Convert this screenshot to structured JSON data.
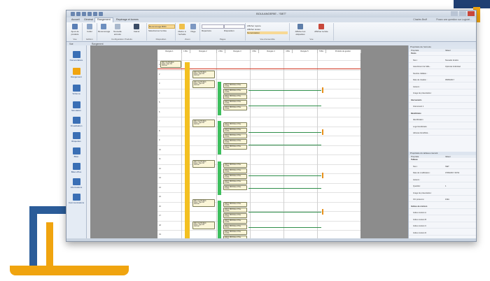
{
  "window": {
    "title": "BOULANGERIE - 'SIET'"
  },
  "tabs": [
    {
      "label": "Accueil"
    },
    {
      "label": "Général"
    },
    {
      "label": "Rangement"
    },
    {
      "label": "Repérage et bornes"
    }
  ],
  "tabs_right": {
    "user": "Charles Bruff",
    "search": "Posez une question sur Logiciel..."
  },
  "ribbon": {
    "groups": [
      {
        "label": "Vue"
      },
      {
        "label": "Edition"
      },
      {
        "label": "Configuration Produits"
      },
      {
        "label": "Disposition"
      },
      {
        "label": "Zoom"
      },
      {
        "label": "Pages"
      },
      {
        "label": "Vue d'ensemble"
      },
      {
        "label": "Vue"
      }
    ],
    "buttons": [
      {
        "label": "Ajout de produits"
      },
      {
        "label": "Coller"
      },
      {
        "label": "Renommage"
      },
      {
        "label": "Nouvelle armoire"
      },
      {
        "label": "Calcul"
      },
      {
        "label": "Renommage BOD"
      },
      {
        "label": "Sélectionner la liste"
      },
      {
        "label": "Répertoire"
      },
      {
        "label": "Mettre à l'échelle"
      },
      {
        "label": "Page"
      },
      {
        "label": "Disposition"
      },
      {
        "label": "Afficher les étiquettes"
      },
      {
        "label": "Afficher la liste"
      }
    ],
    "checks": [
      {
        "label": "Afficher repère"
      },
      {
        "label": "Afficher textes"
      },
      {
        "label": "Numérotation"
      }
    ]
  },
  "docbar": {
    "left": "Vue",
    "tab": "Rangement"
  },
  "leftnav": [
    {
      "label": "Nomenclature"
    },
    {
      "label": "Rangement"
    },
    {
      "label": "Schéma"
    },
    {
      "label": "Simulation"
    },
    {
      "label": "Visualisation"
    },
    {
      "label": "Étiquettes"
    },
    {
      "label": "Bilan"
    },
    {
      "label": "Bilan d'flux"
    },
    {
      "label": "Informations"
    },
    {
      "label": "Communications"
    }
  ],
  "sheet": {
    "columns": [
      {
        "label": "Rangée 1"
      },
      {
        "label": "1 Bis"
      },
      {
        "label": "Rangée 2"
      },
      {
        "label": "2 Bis"
      },
      {
        "label": "Rangée 3"
      },
      {
        "label": "3 Bis"
      },
      {
        "label": "Rangée 4"
      },
      {
        "label": "4 Bis"
      },
      {
        "label": "Rangée 5"
      },
      {
        "label": "5 Bis"
      },
      {
        "label": "Produits de gestion"
      }
    ],
    "rows": [
      "1",
      "2",
      "3",
      "4",
      "5",
      "6",
      "7",
      "8",
      "9",
      "10",
      "11",
      "12",
      "13",
      "14",
      "15",
      "16",
      "17",
      "18",
      "19"
    ],
    "device_title": "DS7-Y2-HF REG",
    "device_tag": "Interr. Type AC",
    "device_button": "Vertical",
    "small_box_title": "DS6T- BRIDGE-2 Pôle",
    "small_box_sub": "C 20A",
    "small_box_button": "Vertical"
  },
  "panel_top": {
    "title": "Propriétés de l'armoire",
    "columns": [
      "Propriété",
      "Valeur"
    ],
    "rows": [
      {
        "k": "Flexio",
        "v": "",
        "cat": true
      },
      {
        "k": "Nom :",
        "v": "Nouvelle fenêtre"
      },
      {
        "k": "Assortiment de l'affa...",
        "v": "Optimisé Individuel"
      },
      {
        "k": "Nombre d'affaire :",
        "v": ""
      },
      {
        "k": "Date de création :",
        "v": "05/05/2017"
      },
      {
        "k": "Auteurs :",
        "v": ""
      },
      {
        "k": "Image de présentation :",
        "v": ""
      },
      {
        "k": "Intervenants",
        "v": "",
        "cat": true
      },
      {
        "k": "Intervenant 1",
        "v": ""
      },
      {
        "k": "Bénéficiaire",
        "v": "",
        "cat": true
      },
      {
        "k": "Identification",
        "v": ""
      },
      {
        "k": "Logo bénéficiaire",
        "v": ""
      },
      {
        "k": "Adresse bénéficiai...",
        "v": ""
      }
    ]
  },
  "panel_bottom": {
    "title": "Propriétés du tableau courant",
    "columns": [
      "Propriété",
      "Valeur"
    ],
    "rows": [
      {
        "k": "Tableau",
        "v": "",
        "cat": true
      },
      {
        "k": "Nom :",
        "v": "SIET"
      },
      {
        "k": "Date de modification :",
        "v": "07/06/2017 09:52"
      },
      {
        "k": "Auteurs :",
        "v": ""
      },
      {
        "k": "Quantité :",
        "v": "1"
      },
      {
        "k": "Image de présentation :",
        "v": ""
      },
      {
        "k": "ICC présumé :",
        "v": "10kA"
      },
      {
        "k": "Indices de révision",
        "v": "",
        "cat": true
      },
      {
        "k": "Indice révision A",
        "v": ""
      },
      {
        "k": "Indice révision B",
        "v": ""
      },
      {
        "k": "Indice révision C",
        "v": ""
      },
      {
        "k": "Indice révision D",
        "v": ""
      },
      {
        "k": "Indice révision E",
        "v": ""
      },
      {
        "k": "Indice révision F",
        "v": ""
      },
      {
        "k": "Numéro d'écran",
        "v": ""
      }
    ]
  }
}
